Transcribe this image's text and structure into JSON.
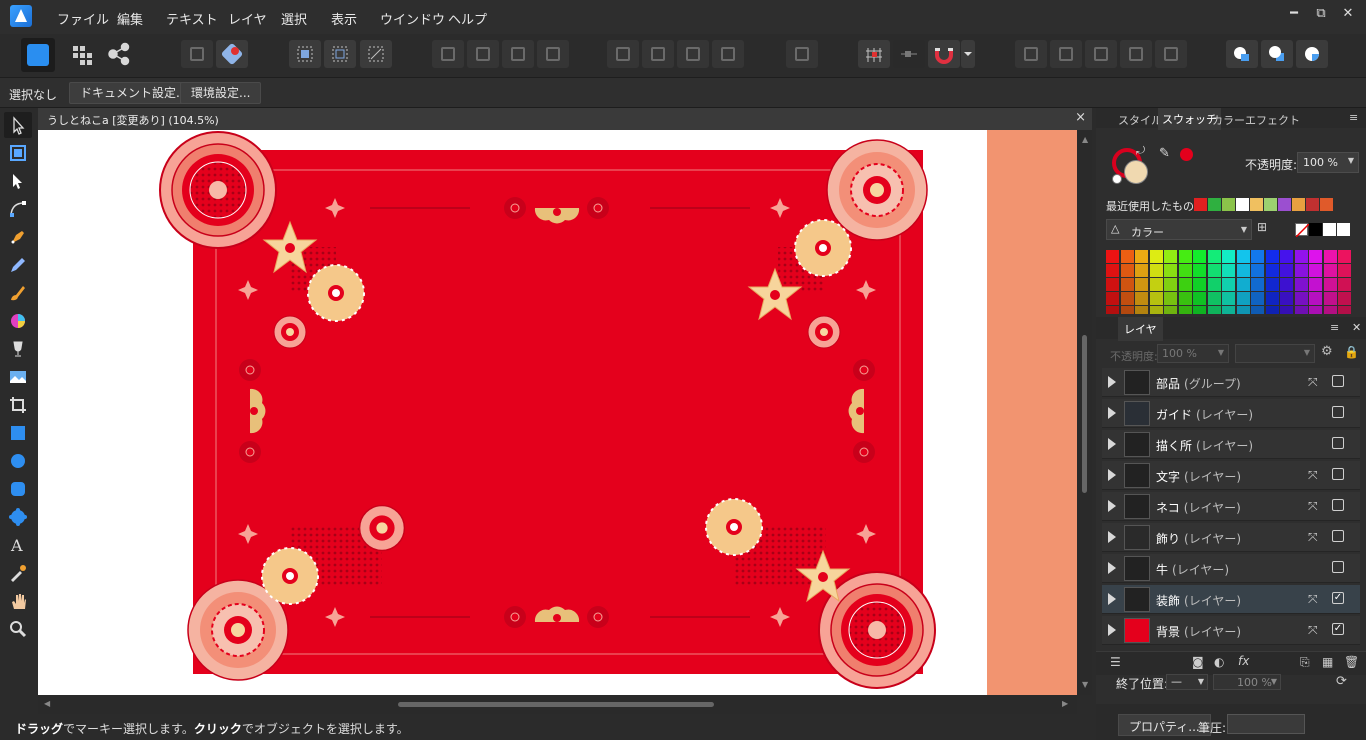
{
  "menu": [
    "ファイル",
    "編集",
    "テキスト",
    "レイヤ",
    "選択",
    "表示",
    "ウインドウ",
    "ヘルプ"
  ],
  "window_controls": {
    "minimize": "━",
    "restore": "⧉",
    "close": "✕"
  },
  "context": {
    "selection": "選択なし",
    "doc_settings": "ドキュメント設定...",
    "env_settings": "環境設定..."
  },
  "document": {
    "tab_title": "うしとねこa [変更あり] (104.5%)",
    "close": "×"
  },
  "panel": {
    "tabs": [
      "スタイル",
      "スウォッチ",
      "カラー",
      "エフェクト"
    ],
    "opacity_label": "不透明度:",
    "opacity_value": "100 %",
    "recent_label": "最近使用したもの:",
    "palette_name": "カラー",
    "recent_colors": [
      "#e02020",
      "#2fb040",
      "#8bc34a",
      "#ffffff",
      "#f0c060",
      "#9cd070",
      "#9b4fd0",
      "#e8a040",
      "#c03030",
      "#e05a2a"
    ]
  },
  "layers": {
    "tab": "レイヤ",
    "opacity_label": "不透明度:",
    "opacity_value": "100 %",
    "items": [
      {
        "name": "部品",
        "kind": "(グループ)",
        "locked": true,
        "visible": false
      },
      {
        "name": "ガイド",
        "kind": "(レイヤー)",
        "locked": false,
        "visible": false
      },
      {
        "name": "描く所",
        "kind": "(レイヤー)",
        "locked": false,
        "visible": false
      },
      {
        "name": "文字",
        "kind": "(レイヤー)",
        "locked": true,
        "visible": false
      },
      {
        "name": "ネコ",
        "kind": "(レイヤー)",
        "locked": true,
        "visible": false
      },
      {
        "name": "飾り",
        "kind": "(レイヤー)",
        "locked": true,
        "visible": false
      },
      {
        "name": "牛",
        "kind": "(レイヤー)",
        "locked": false,
        "visible": false
      },
      {
        "name": "装飾",
        "kind": "(レイヤー)",
        "locked": true,
        "visible": true
      },
      {
        "name": "背景",
        "kind": "(レイヤー)",
        "locked": true,
        "visible": true
      }
    ]
  },
  "stroke": {
    "end_label": "終了位置:",
    "value": "100 %"
  },
  "bottom": {
    "properties": "プロパティ...",
    "pressure": "筆圧:"
  },
  "status": {
    "drag": "ドラッグ",
    "t1": "でマーキー選択します。",
    "click": "クリック",
    "t2": "でオブジェクトを選択します。"
  }
}
